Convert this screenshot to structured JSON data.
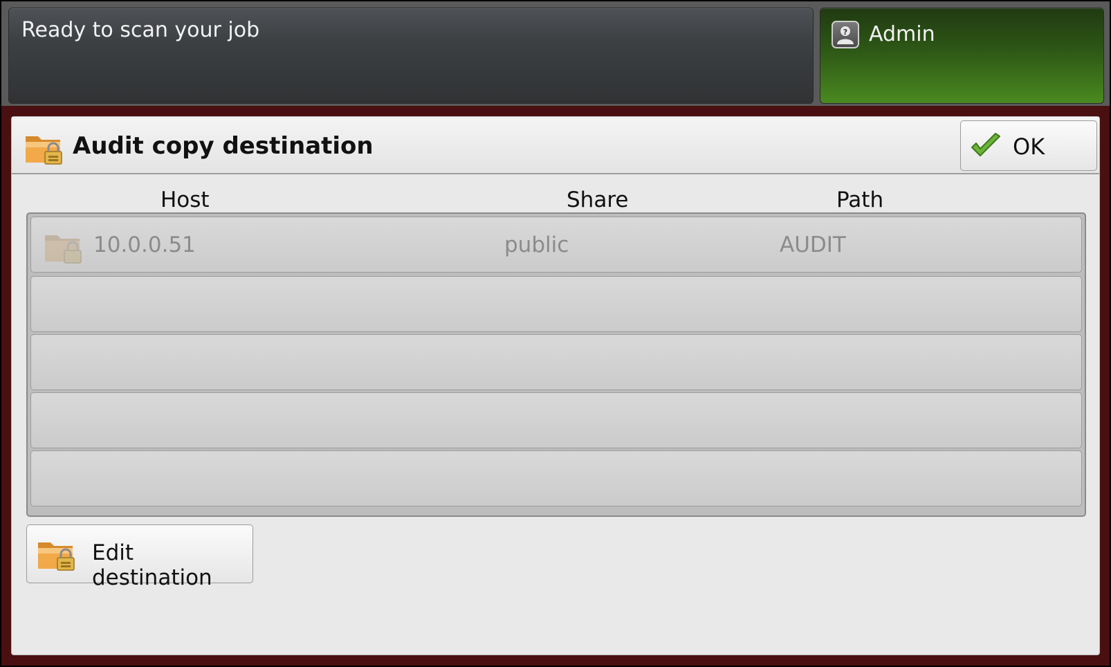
{
  "status": {
    "message": "Ready to scan your job"
  },
  "user": {
    "label": "Admin",
    "icon": "user-lock-icon"
  },
  "dialog": {
    "title": "Audit copy destination",
    "title_icon": "locked-folder-icon",
    "ok_label": "OK",
    "ok_icon": "checkmark-icon"
  },
  "table": {
    "columns": [
      "Host",
      "Share",
      "Path"
    ],
    "rows": [
      {
        "host": "10.0.0.51",
        "share": "public",
        "path": "AUDIT",
        "icon": "locked-folder-icon"
      }
    ]
  },
  "actions": {
    "edit_label": "Edit destination",
    "edit_icon": "locked-folder-icon"
  },
  "colors": {
    "frame": "#4a0f10",
    "admin_green": "#4a8a20",
    "status_dark": "#3d4043"
  }
}
